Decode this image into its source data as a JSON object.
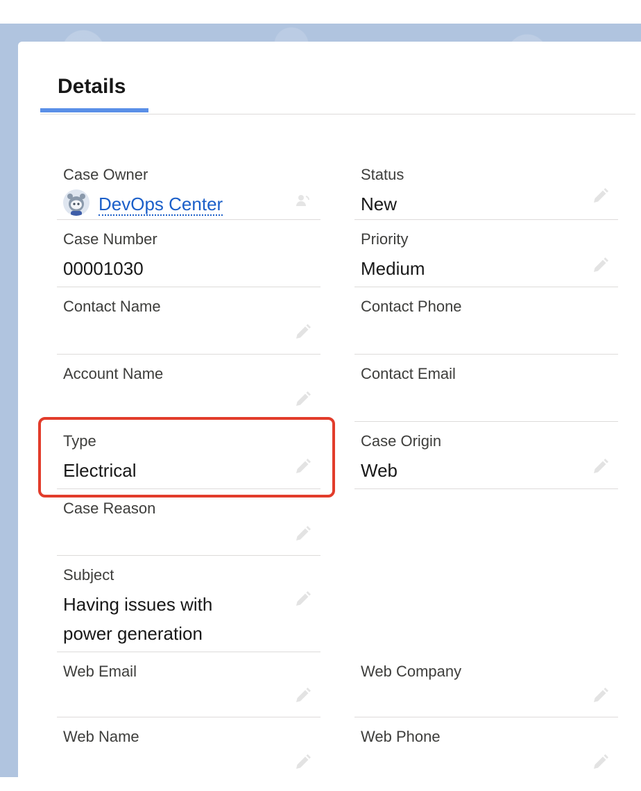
{
  "tab": {
    "title": "Details"
  },
  "fields": {
    "case_owner": {
      "label": "Case Owner",
      "value": "DevOps Center"
    },
    "status": {
      "label": "Status",
      "value": "New"
    },
    "case_number": {
      "label": "Case Number",
      "value": "00001030"
    },
    "priority": {
      "label": "Priority",
      "value": "Medium"
    },
    "contact_name": {
      "label": "Contact Name",
      "value": ""
    },
    "contact_phone": {
      "label": "Contact Phone",
      "value": ""
    },
    "account_name": {
      "label": "Account Name",
      "value": ""
    },
    "contact_email": {
      "label": "Contact Email",
      "value": ""
    },
    "type": {
      "label": "Type",
      "value": "Electrical"
    },
    "case_origin": {
      "label": "Case Origin",
      "value": "Web"
    },
    "case_reason": {
      "label": "Case Reason",
      "value": ""
    },
    "subject": {
      "label": "Subject",
      "value_line1": "Having issues with",
      "value_line2": "power generation"
    },
    "web_email": {
      "label": "Web Email",
      "value": ""
    },
    "web_company": {
      "label": "Web Company",
      "value": ""
    },
    "web_name": {
      "label": "Web Name",
      "value": ""
    },
    "web_phone": {
      "label": "Web Phone",
      "value": ""
    }
  },
  "icons": {
    "edit": "pencil-icon",
    "owner_avatar": "astro-avatar-icon",
    "change_owner": "change-owner-icon"
  },
  "colors": {
    "link": "#1b5fc9",
    "tab_underline": "#5a8fe7",
    "highlight_border": "#e23c2b",
    "backdrop": "#b0c4df"
  }
}
